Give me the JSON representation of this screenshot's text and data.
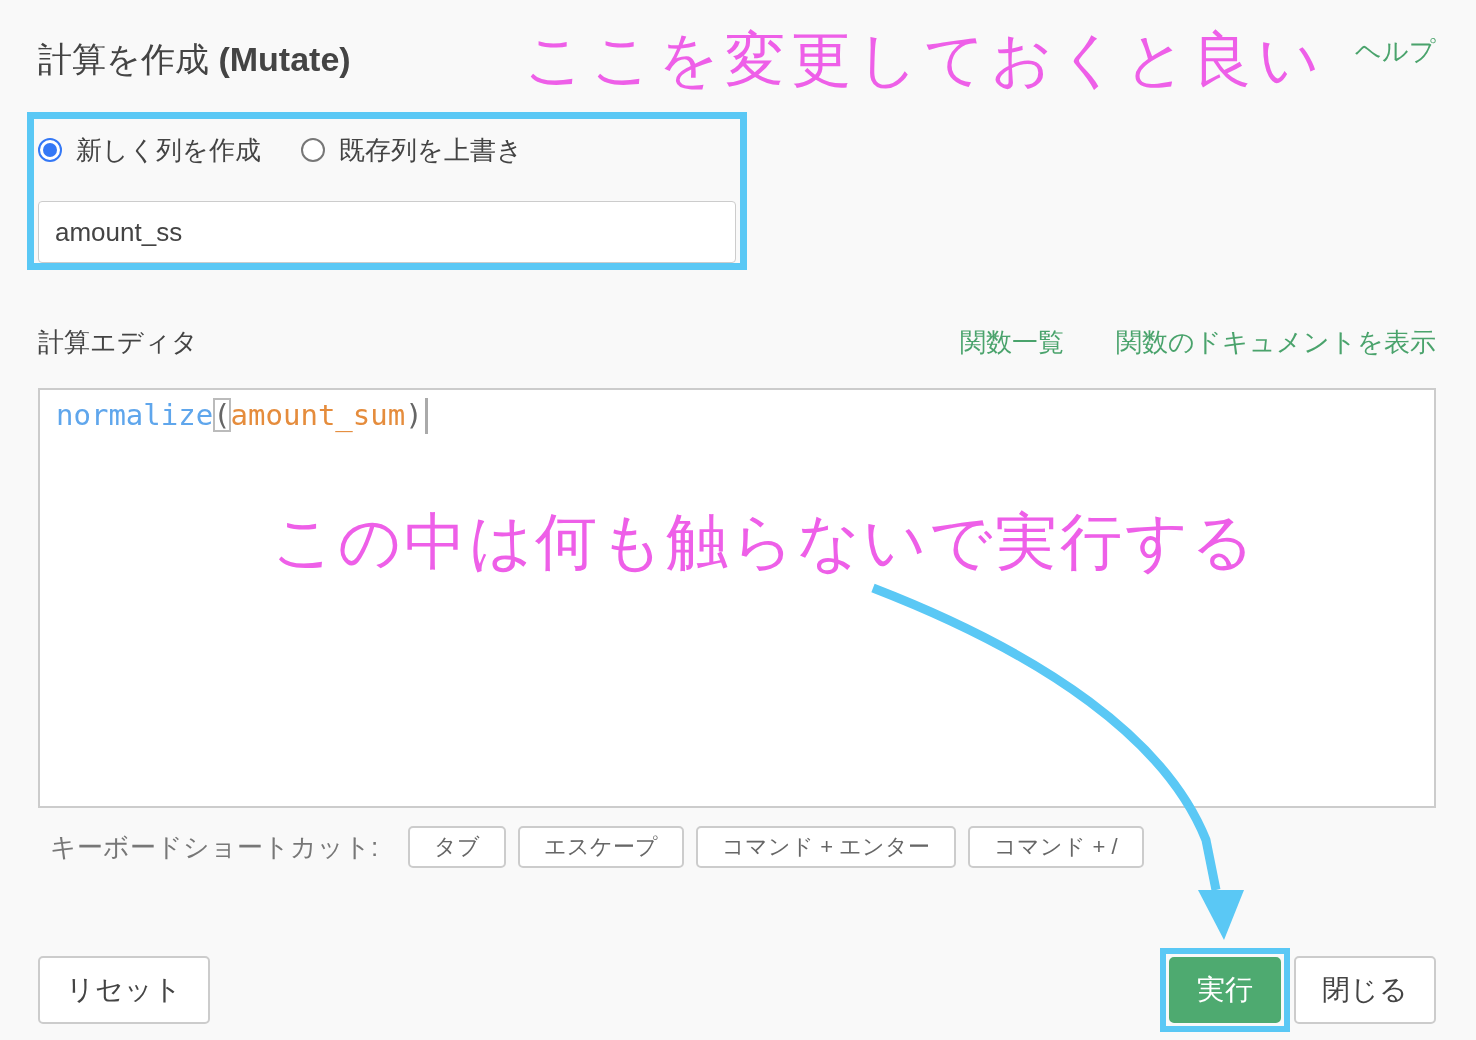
{
  "title": {
    "main": "計算を作成",
    "sub": "(Mutate)"
  },
  "help_link": "ヘルプ",
  "mode_options": [
    {
      "label": "新しく列を作成",
      "selected": true
    },
    {
      "label": "既存列を上書き",
      "selected": false
    }
  ],
  "column_name": {
    "value": "amount_ss"
  },
  "editor": {
    "label": "計算エディタ",
    "links": [
      "関数一覧",
      "関数のドキュメントを表示"
    ],
    "code": [
      {
        "kind": "function",
        "text": "normalize"
      },
      {
        "kind": "bracket",
        "text": "("
      },
      {
        "kind": "argument",
        "text": "amount_sum"
      },
      {
        "kind": "bracket",
        "text": ")"
      }
    ]
  },
  "shortcuts": {
    "label": "キーボードショートカット:",
    "keys": [
      "タブ",
      "エスケープ",
      "コマンド + エンター",
      "コマンド + /"
    ]
  },
  "buttons": {
    "reset": "リセット",
    "run": "実行",
    "close": "閉じる"
  },
  "annotations": [
    {
      "kind": "note",
      "text": "ここを変更しておくと良い"
    },
    {
      "kind": "note",
      "text": "この中は何も触らないで実行する"
    }
  ]
}
